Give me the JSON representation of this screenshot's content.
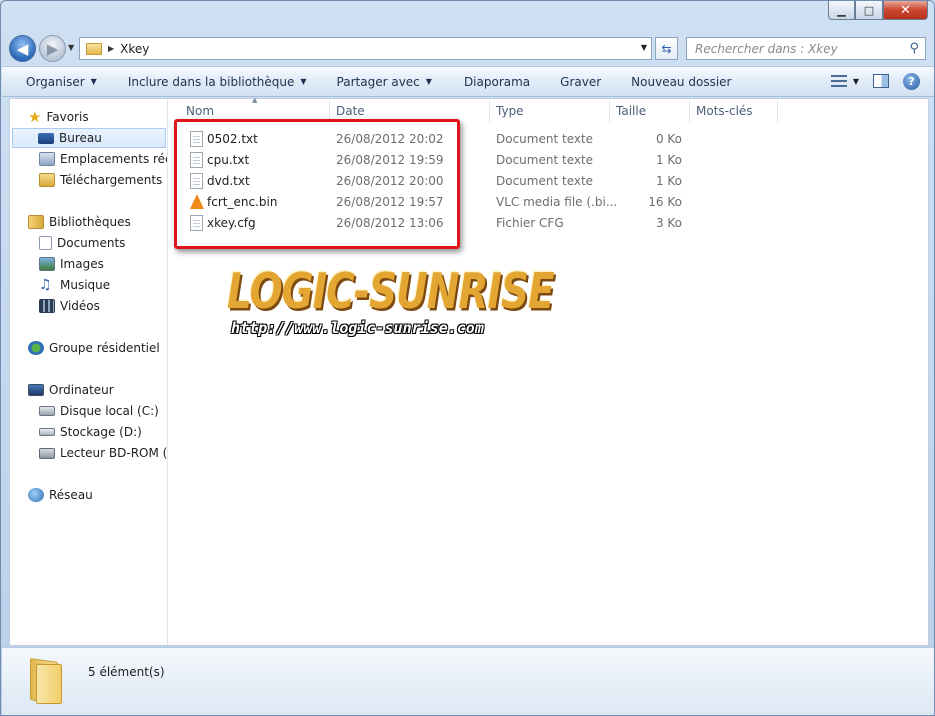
{
  "window": {
    "title_controls": {
      "minimize": "▁",
      "maximize": "□",
      "close": "✕"
    }
  },
  "address": {
    "path": "Xkey",
    "search_placeholder": "Rechercher dans : Xkey"
  },
  "toolbar": {
    "items": [
      "Organiser",
      "Inclure dans la bibliothèque",
      "Partager avec",
      "Diaporama",
      "Graver",
      "Nouveau dossier"
    ],
    "help": "?"
  },
  "sidebar": {
    "favoris": "Favoris",
    "bureau": "Bureau",
    "emplacements": "Emplacements récen",
    "telechargements": "Téléchargements",
    "bibliotheques": "Bibliothèques",
    "documents": "Documents",
    "images": "Images",
    "musique": "Musique",
    "videos": "Vidéos",
    "groupe": "Groupe résidentiel",
    "ordinateur": "Ordinateur",
    "disque": "Disque local (C:)",
    "stockage": "Stockage (D:)",
    "lecteur": "Lecteur BD-ROM (G:",
    "reseau": "Réseau"
  },
  "columns": {
    "name": "Nom",
    "date": "Date",
    "type": "Type",
    "size": "Taille",
    "tags": "Mots-clés"
  },
  "files": [
    {
      "name": "0502.txt",
      "date": "26/08/2012 20:02",
      "type": "Document texte",
      "size": "0 Ko",
      "icon": "text-file-icon"
    },
    {
      "name": "cpu.txt",
      "date": "26/08/2012 19:59",
      "type": "Document texte",
      "size": "1 Ko",
      "icon": "text-file-icon"
    },
    {
      "name": "dvd.txt",
      "date": "26/08/2012 20:00",
      "type": "Document texte",
      "size": "1 Ko",
      "icon": "text-file-icon"
    },
    {
      "name": "fcrt_enc.bin",
      "date": "26/08/2012 19:57",
      "type": "VLC media file (.bi...",
      "size": "16 Ko",
      "icon": "vlc-icon"
    },
    {
      "name": "xkey.cfg",
      "date": "26/08/2012 13:06",
      "type": "Fichier CFG",
      "size": "3 Ko",
      "icon": "blank-file-icon"
    }
  ],
  "watermark": {
    "logo": "LOGIC-SUNRISE",
    "url": "http://www.logic-sunrise.com"
  },
  "status": {
    "count": "5 élément(s)"
  },
  "colors": {
    "highlight_box": "#e0141b",
    "logo": "#e3a632"
  }
}
